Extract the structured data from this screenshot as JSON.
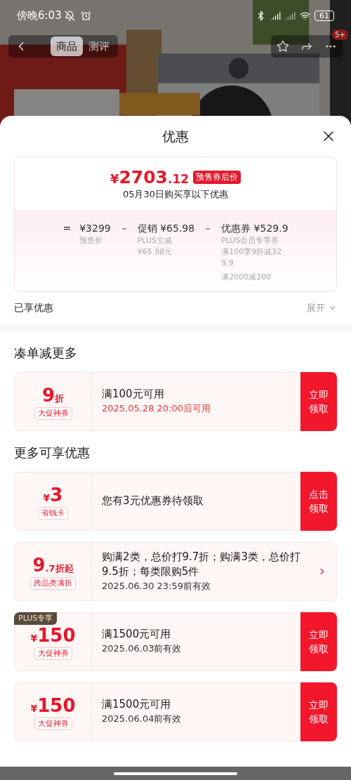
{
  "status_bar": {
    "time": "傍晚6:03",
    "battery": "61"
  },
  "nav": {
    "tabs": [
      {
        "label": "商品",
        "selected": true
      },
      {
        "label": "测评",
        "selected": false
      }
    ],
    "badge": "5+"
  },
  "sheet": {
    "title": "优惠",
    "summary": {
      "currency": "¥",
      "price": "2703",
      "cents": ".12",
      "tag": "预售券后价",
      "subtitle": "05月30日购买享以下优惠",
      "breakdown": [
        {
          "op": "=",
          "main": "¥3299",
          "notes": [
            "预售价"
          ]
        },
        {
          "op": "－",
          "main": "促销 ¥65.98",
          "notes": [
            "PLUS立减",
            "¥65.98元"
          ]
        },
        {
          "op": "－",
          "main": "优惠券 ¥529.9",
          "notes": [
            "PLUS会员专享券",
            "满100享9折减329.9",
            "满2000减200"
          ]
        }
      ]
    },
    "enjoyed": {
      "label": "已享优惠",
      "toggle": "展开",
      "expanded": false
    },
    "sections": [
      {
        "title": "凑单减更多",
        "coupons": [
          {
            "kind": "claim",
            "value": "9",
            "suffix": "折",
            "badge": "大促神券",
            "title": "满100元可用",
            "validity": "2025.05.28 20:00后可用",
            "validity_highlighted": true,
            "action": "立即领取"
          }
        ]
      },
      {
        "title": "更多可享优惠",
        "coupons": [
          {
            "kind": "claim",
            "prefix": "¥",
            "value": "3",
            "badge": "省钱卡",
            "title": "您有3元优惠券待领取",
            "action": "点击领取"
          },
          {
            "kind": "link",
            "value": "9",
            "suffix": ".7折起",
            "badge": "跨品类满折",
            "title": "购满2类，总价打9.7折；购满3类，总价打9.5折；每类限购5件",
            "validity": "2025.06.30 23:59前有效",
            "validity_highlighted": false
          },
          {
            "kind": "claim",
            "tag": "PLUS专享",
            "prefix": "¥",
            "value": "150",
            "badge": "大促神券",
            "title": "满1500元可用",
            "validity": "2025.06.03前有效",
            "validity_highlighted": false,
            "action": "立即领取"
          },
          {
            "kind": "claim",
            "prefix": "¥",
            "value": "150",
            "badge": "大促神券",
            "title": "满1500元可用",
            "validity": "2025.06.04前有效",
            "validity_highlighted": false,
            "action": "立即领取"
          }
        ]
      }
    ]
  }
}
